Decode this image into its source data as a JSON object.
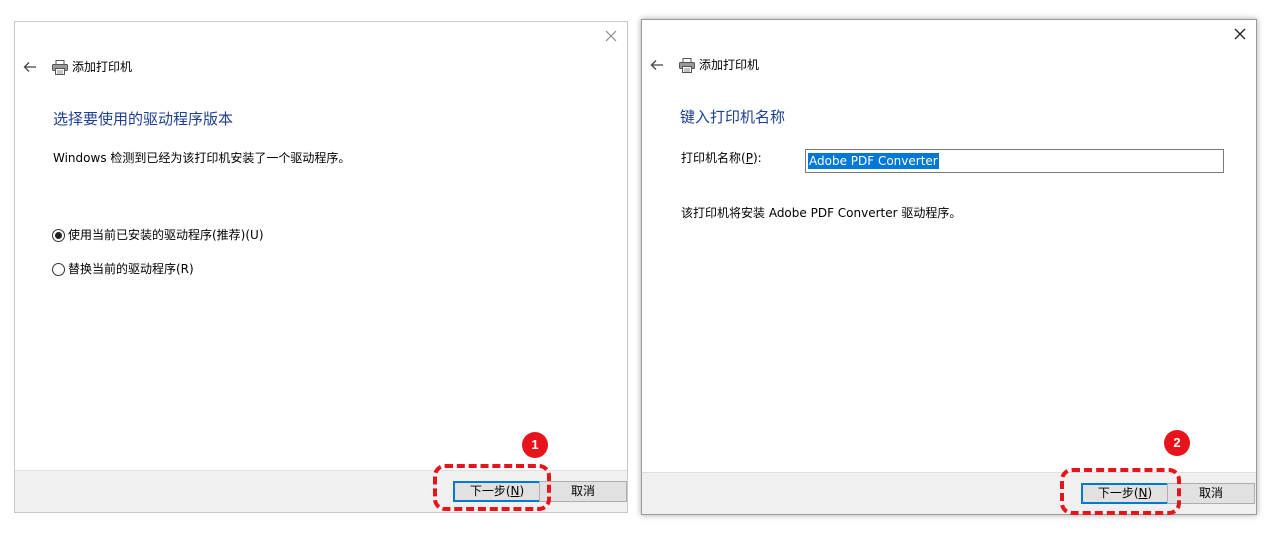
{
  "dialog1": {
    "title": "添加打印机",
    "heading": "选择要使用的驱动程序版本",
    "description": "Windows 检测到已经为该打印机安装了一个驱动程序。",
    "options": [
      {
        "label": "使用当前已安装的驱动程序(推荐)(U)",
        "selected": true
      },
      {
        "label": "替换当前的驱动程序(R)",
        "selected": false
      }
    ],
    "next_label_pre": "下一步(",
    "next_label_key": "N",
    "next_label_post": ")",
    "cancel_label": "取消",
    "step": "1"
  },
  "dialog2": {
    "title": "添加打印机",
    "heading": "键入打印机名称",
    "field_label_pre": "打印机名称(",
    "field_label_key": "P",
    "field_label_post": "):",
    "field_value": "Adobe PDF Converter",
    "description": "该打印机将安装 Adobe PDF Converter 驱动程序。",
    "next_label_pre": "下一步(",
    "next_label_key": "N",
    "next_label_post": ")",
    "cancel_label": "取消",
    "step": "2"
  },
  "colors": {
    "heading": "#1c3f94",
    "accent": "#0078d7",
    "annotation": "#e8141b"
  },
  "icons": [
    "close-icon",
    "back-arrow-icon",
    "printer-icon",
    "radio-button-icon"
  ]
}
